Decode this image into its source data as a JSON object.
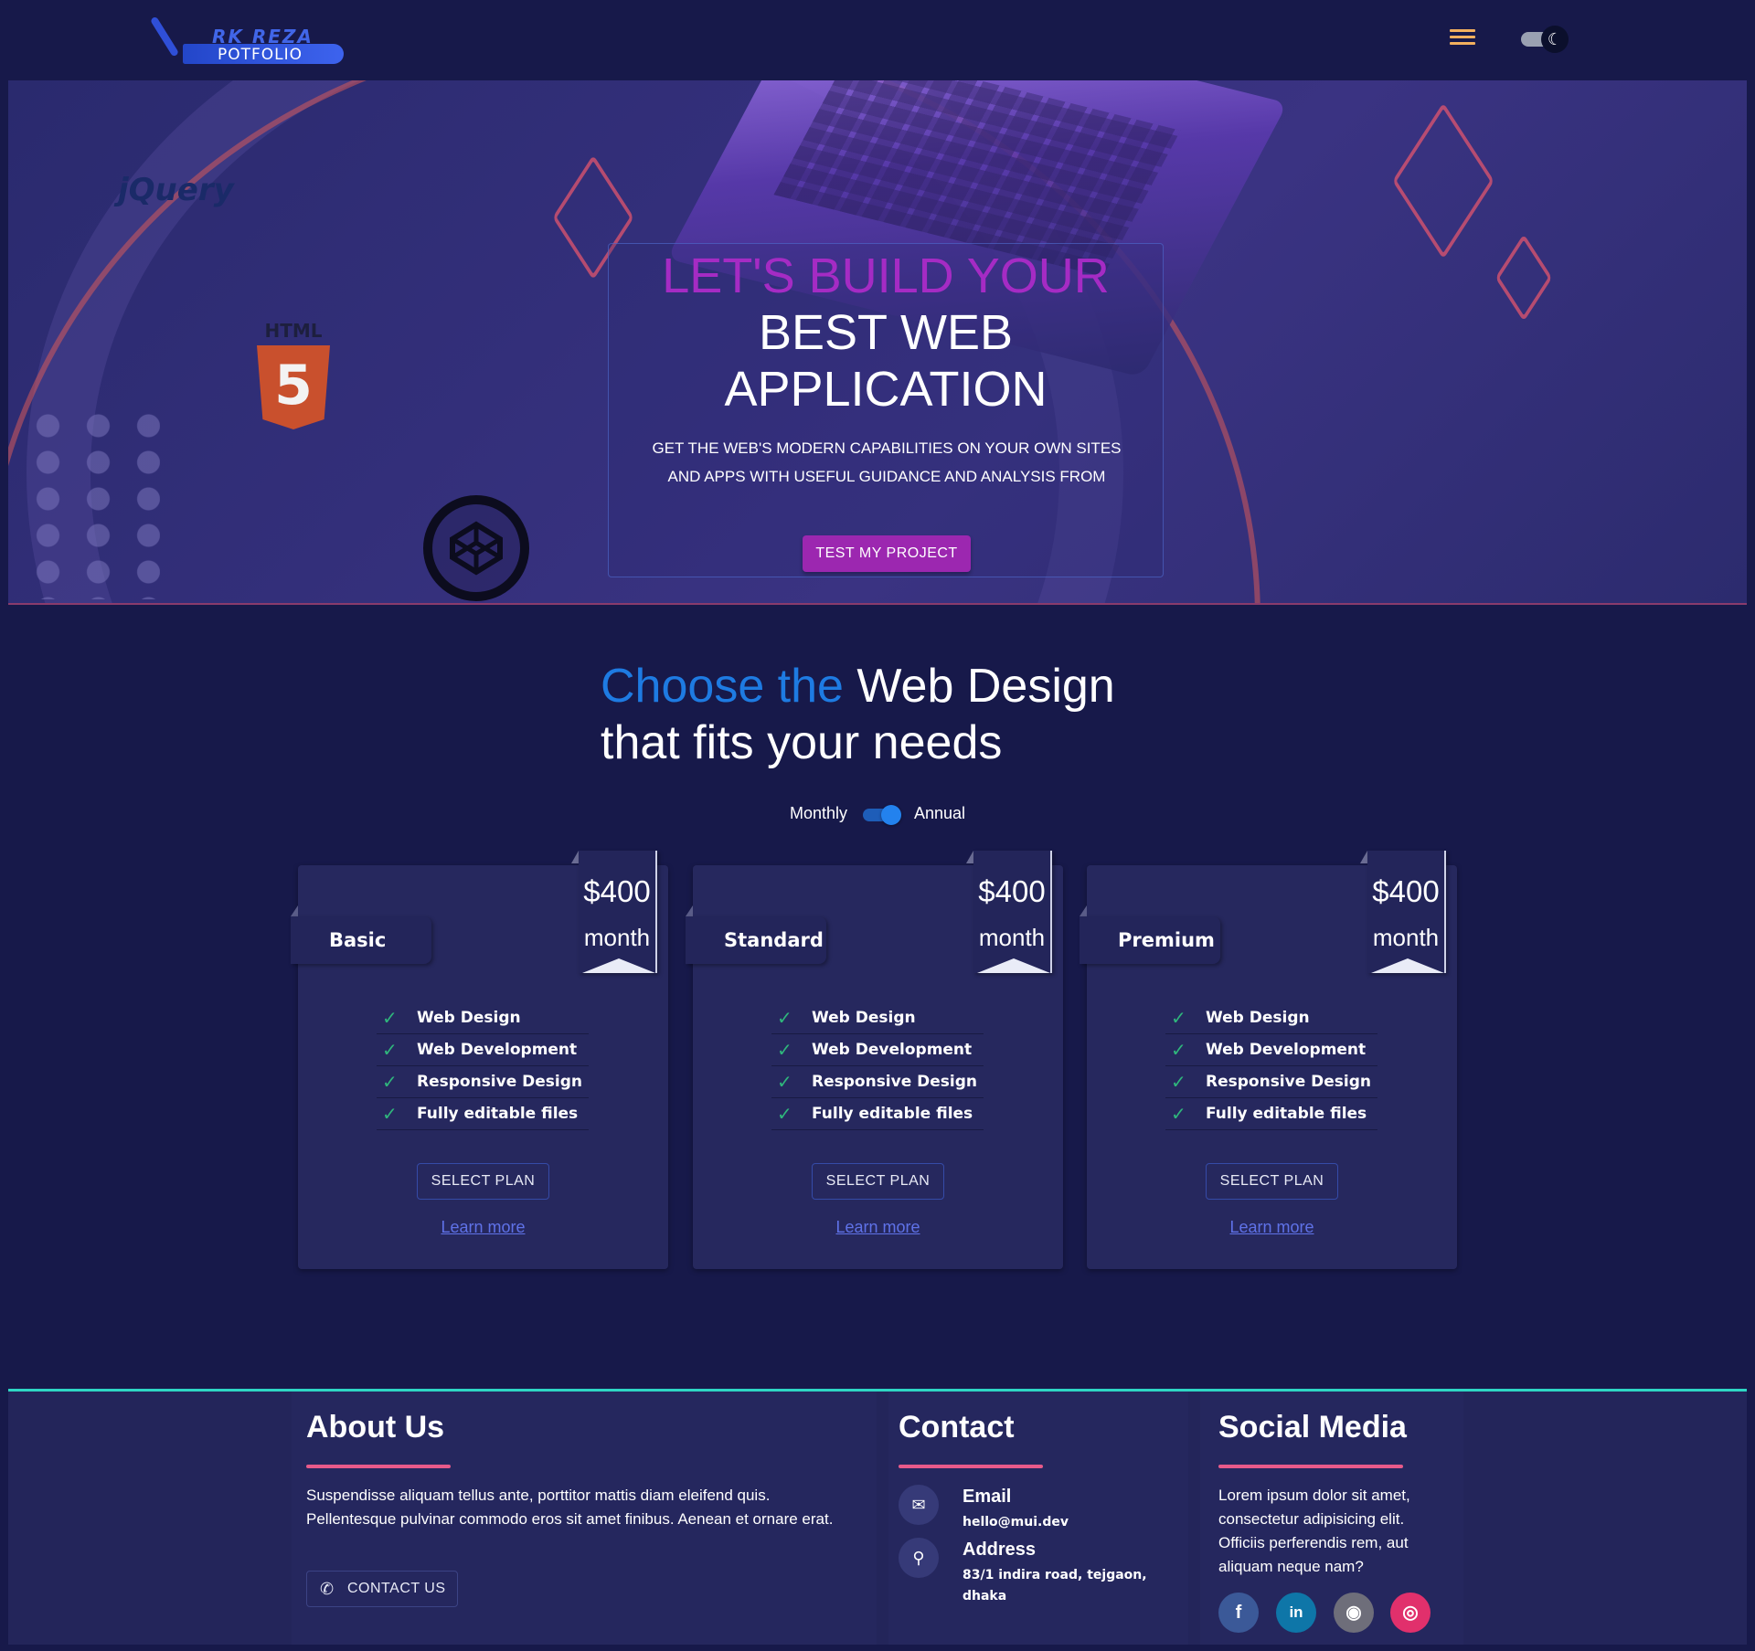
{
  "header": {
    "logo_line1": "RK REZA",
    "logo_line2": "POTFOLIO",
    "menu_icon": "hamburger-menu-icon",
    "theme_icon": "moon-icon",
    "theme_glyph": "☾"
  },
  "hero": {
    "title_line1": "LET'S BUILD YOUR",
    "title_line2": "BEST WEB",
    "title_line3": "APPLICATION",
    "subtitle": "GET THE WEB'S MODERN CAPABILITIES ON YOUR OWN SITES AND APPS WITH USEFUL GUIDANCE AND ANALYSIS FROM",
    "cta_label": "TEST MY PROJECT",
    "logo_jquery": "jQuery",
    "logo_html": "HTML",
    "logo_html_number": "5",
    "accent_color": "#9c27b0"
  },
  "pricing": {
    "heading_accent": "Choose the",
    "heading_rest": " Web Design",
    "heading_line2": "that fits your needs",
    "billing_monthly": "Monthly",
    "billing_annual": "Annual",
    "annual_selected": true,
    "plans": [
      {
        "name": "Basic",
        "price": "$400",
        "period": "month",
        "features": [
          "Web Design",
          "Web Development",
          "Responsive Design",
          "Fully editable files"
        ],
        "select_label": "SELECT PLAN",
        "learn_label": "Learn more"
      },
      {
        "name": "Standard",
        "price": "$400",
        "period": "month",
        "features": [
          "Web Design",
          "Web Development",
          "Responsive Design",
          "Fully editable files"
        ],
        "select_label": "SELECT PLAN",
        "learn_label": "Learn more"
      },
      {
        "name": "Premium",
        "price": "$400",
        "period": "month",
        "features": [
          "Web Design",
          "Web Development",
          "Responsive Design",
          "Fully editable files"
        ],
        "select_label": "SELECT PLAN",
        "learn_label": "Learn more"
      }
    ]
  },
  "footer": {
    "about": {
      "title": "About Us",
      "text": "Suspendisse aliquam tellus ante, porttitor mattis diam eleifend quis. Pellentesque pulvinar commodo eros sit amet finibus. Aenean et ornare erat.",
      "contact_label": "CONTACT US"
    },
    "contact": {
      "title": "Contact",
      "email_label": "Email",
      "email_value": "hello@mui.dev",
      "address_label": "Address",
      "address_value": "83/1 indira road, tejgaon, dhaka"
    },
    "social": {
      "title": "Social Media",
      "text": "Lorem ipsum dolor sit amet, consectetur adipisicing elit. Officiis perferendis rem, aut aliquam neque nam?",
      "icons": [
        {
          "name": "facebook-icon",
          "glyph": "f",
          "color": "#3b5998"
        },
        {
          "name": "linkedin-icon",
          "glyph": "in",
          "color": "#0e76a8"
        },
        {
          "name": "github-icon",
          "glyph": "◉",
          "color": "#6e6e7a"
        },
        {
          "name": "instagram-icon",
          "glyph": "◎",
          "color": "#e1306c"
        }
      ]
    },
    "accent_color": "#2ed6c4",
    "underline_color": "#e85a8a"
  }
}
